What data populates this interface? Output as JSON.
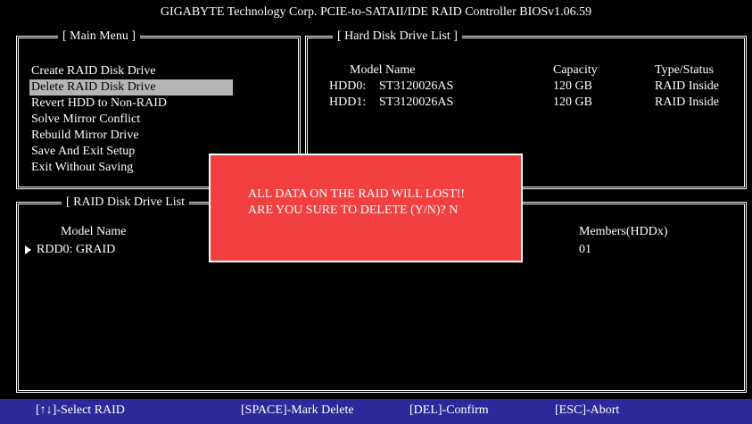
{
  "title": "GIGABYTE Technology Corp. PCIE-to-SATAII/IDE RAID Controller BIOSv1.06.59",
  "main_menu": {
    "label": "[ Main Menu ]",
    "items": [
      "Create RAID Disk Drive",
      "Delete RAID Disk Drive",
      "Revert HDD to Non-RAID",
      "Solve Mirror Conflict",
      "Rebuild Mirror Drive",
      "Save And Exit Setup",
      "Exit Without Saving"
    ],
    "selected_index": 1
  },
  "hdd_list": {
    "label": "[ Hard Disk Drive List ]",
    "headers": {
      "model": "Model Name",
      "capacity": "Capacity",
      "type": "Type/Status"
    },
    "rows": [
      {
        "id": "HDD0:",
        "model": "ST3120026AS",
        "capacity": "120 GB",
        "type": "RAID Inside"
      },
      {
        "id": "HDD1:",
        "model": "ST3120026AS",
        "capacity": "120 GB",
        "type": "RAID Inside"
      }
    ]
  },
  "raid_list": {
    "label": "[ RAID Disk Drive List",
    "headers": {
      "model": "Model Name",
      "members": "Members(HDDx)"
    },
    "rows": [
      {
        "name": "RDD0: GRAID",
        "members": "01"
      }
    ]
  },
  "dialog": {
    "line1": "ALL DATA ON THE RAID WILL LOST!!",
    "line2": "ARE YOU SURE TO DELETE (Y/N)? N"
  },
  "footer": {
    "select": "[↑↓]-Select RAID",
    "mark": "[SPACE]-Mark Delete",
    "confirm": "[DEL]-Confirm",
    "abort": "[ESC]-Abort"
  },
  "colors": {
    "background": "#000000",
    "dialog": "#f24040",
    "footer": "#2b2a9a",
    "selection": "#b5b5b5"
  }
}
